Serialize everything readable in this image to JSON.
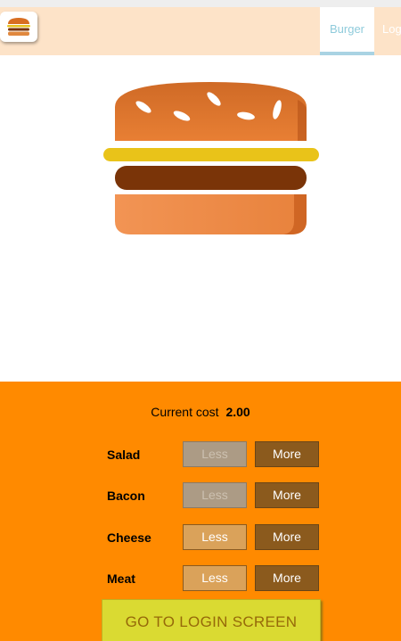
{
  "toolbar": {
    "logo_icon": "burger-logo-icon",
    "nav": [
      {
        "label": "Burger",
        "active": true
      },
      {
        "label": "Log"
      }
    ]
  },
  "controls": {
    "cost_label": "Current cost",
    "cost_value": "2.00",
    "ingredients": [
      {
        "label": "Salad",
        "less": "Less",
        "more": "More",
        "less_disabled": true
      },
      {
        "label": "Bacon",
        "less": "Less",
        "more": "More",
        "less_disabled": true
      },
      {
        "label": "Cheese",
        "less": "Less",
        "more": "More",
        "less_disabled": false
      },
      {
        "label": "Meat",
        "less": "Less",
        "more": "More",
        "less_disabled": false
      }
    ],
    "login_button": "GO TO LOGIN SCREEN"
  },
  "colors": {
    "toolbar_bg": "#fde3c8",
    "controls_bg": "#ff8a00",
    "more_button": "#8b5a1d",
    "less_button": "#daa25a",
    "login_button": "#dada32"
  }
}
